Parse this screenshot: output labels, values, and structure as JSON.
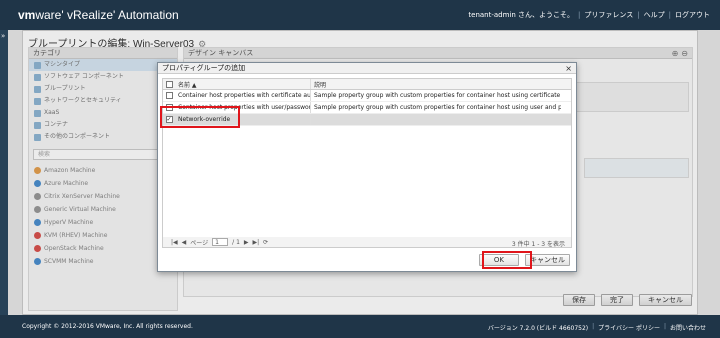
{
  "header": {
    "brand_bold": "vm",
    "brand_rest": "ware' vRealize' Automation",
    "user": "tenant-admin さん、ようこそ。",
    "links": [
      "プリファレンス",
      "ヘルプ",
      "ログアウト"
    ]
  },
  "left_strip": {
    "icon": "chevron-double-right-icon",
    "glyph": "»"
  },
  "page": {
    "title": "ブループリントの編集: Win-Server03",
    "gear_glyph": "⚙"
  },
  "categories": {
    "header": "カテゴリ",
    "items": [
      "マシンタイプ",
      "ソフトウェア コンポーネント",
      "ブループリント",
      "ネットワークとセキュリティ",
      "XaaS",
      "コンテナ",
      "その他のコンポーネント"
    ],
    "search_placeholder": "検索",
    "search_glyph": "🔍",
    "machines": [
      "Amazon Machine",
      "Azure Machine",
      "Citrix XenServer Machine",
      "Generic Virtual Machine",
      "HyperV Machine",
      "KVM (RHEV) Machine",
      "OpenStack Machine",
      "SCVMM Machine"
    ]
  },
  "canvas": {
    "header": "デザイン キャンバス",
    "zoom_in": "⊕",
    "zoom_out": "⊖"
  },
  "page_buttons": {
    "save": "保存",
    "finish": "完了",
    "cancel": "キャンセル"
  },
  "dialog": {
    "title": "プロパティグループの追加",
    "close_glyph": "×",
    "col_name": "名前 ▲",
    "col_desc": "説明",
    "rows": [
      {
        "name": "Container host properties with certificate authe...",
        "desc": "Sample property group with custom properties for container host using certificate and private key f...",
        "checked": false,
        "selected": false
      },
      {
        "name": "Container host properties with user/password ...",
        "desc": "Sample property group with custom properties for container host using user and password credent...",
        "checked": false,
        "selected": false
      },
      {
        "name": "Network-override",
        "desc": "",
        "checked": true,
        "selected": true
      }
    ],
    "pager": {
      "page_label": "ページ",
      "page_value": "1",
      "page_total": "/ 1",
      "info": "3 件中 1 - 3 を表示"
    },
    "ok": "OK",
    "cancel": "キャンセル"
  },
  "footer": {
    "copyright": "Copyright © 2012-2016 VMware, Inc. All rights reserved.",
    "version": "バージョン 7.2.0 (ビルド 4660752)",
    "privacy": "プライバシー ポリシー",
    "contact": "お問い合わせ"
  },
  "colors": {
    "header_bg": "#1f3548",
    "highlight": "#e0151b",
    "selected_row": "#dcdcdc"
  }
}
